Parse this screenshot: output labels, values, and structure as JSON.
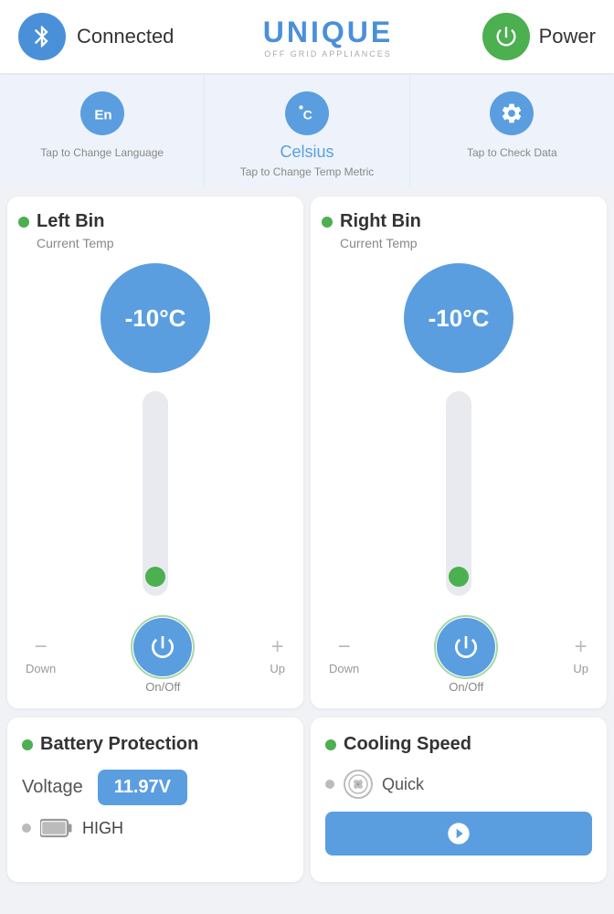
{
  "header": {
    "connected_label": "Connected",
    "logo_main": "UNIQUE",
    "logo_sub": "OFF GRID  APPLIANCES",
    "power_label": "Power"
  },
  "controls": [
    {
      "id": "language",
      "icon": "en",
      "main_label": "En",
      "sub_label": "Tap to Change Language"
    },
    {
      "id": "temp",
      "icon": "celsius",
      "main_label": "Celsius",
      "sub_label": "Tap to Change Temp Metric"
    },
    {
      "id": "data",
      "icon": "gear",
      "main_label": "",
      "sub_label": "Tap to Check Data"
    }
  ],
  "bins": [
    {
      "id": "left",
      "title": "Left Bin",
      "subtitle": "Current Temp",
      "temp": "-10°C",
      "down_label": "Down",
      "up_label": "Up",
      "onoff_label": "On/Off"
    },
    {
      "id": "right",
      "title": "Right Bin",
      "subtitle": "Current Temp",
      "temp": "-10°C",
      "down_label": "Down",
      "up_label": "Up",
      "onoff_label": "On/Off"
    }
  ],
  "bottom": {
    "battery": {
      "title": "Battery Protection",
      "voltage_label": "Voltage",
      "voltage_value": "11.97V",
      "level_label": "HIGH"
    },
    "cooling": {
      "title": "Cooling Speed",
      "speed_label": "Quick"
    }
  }
}
